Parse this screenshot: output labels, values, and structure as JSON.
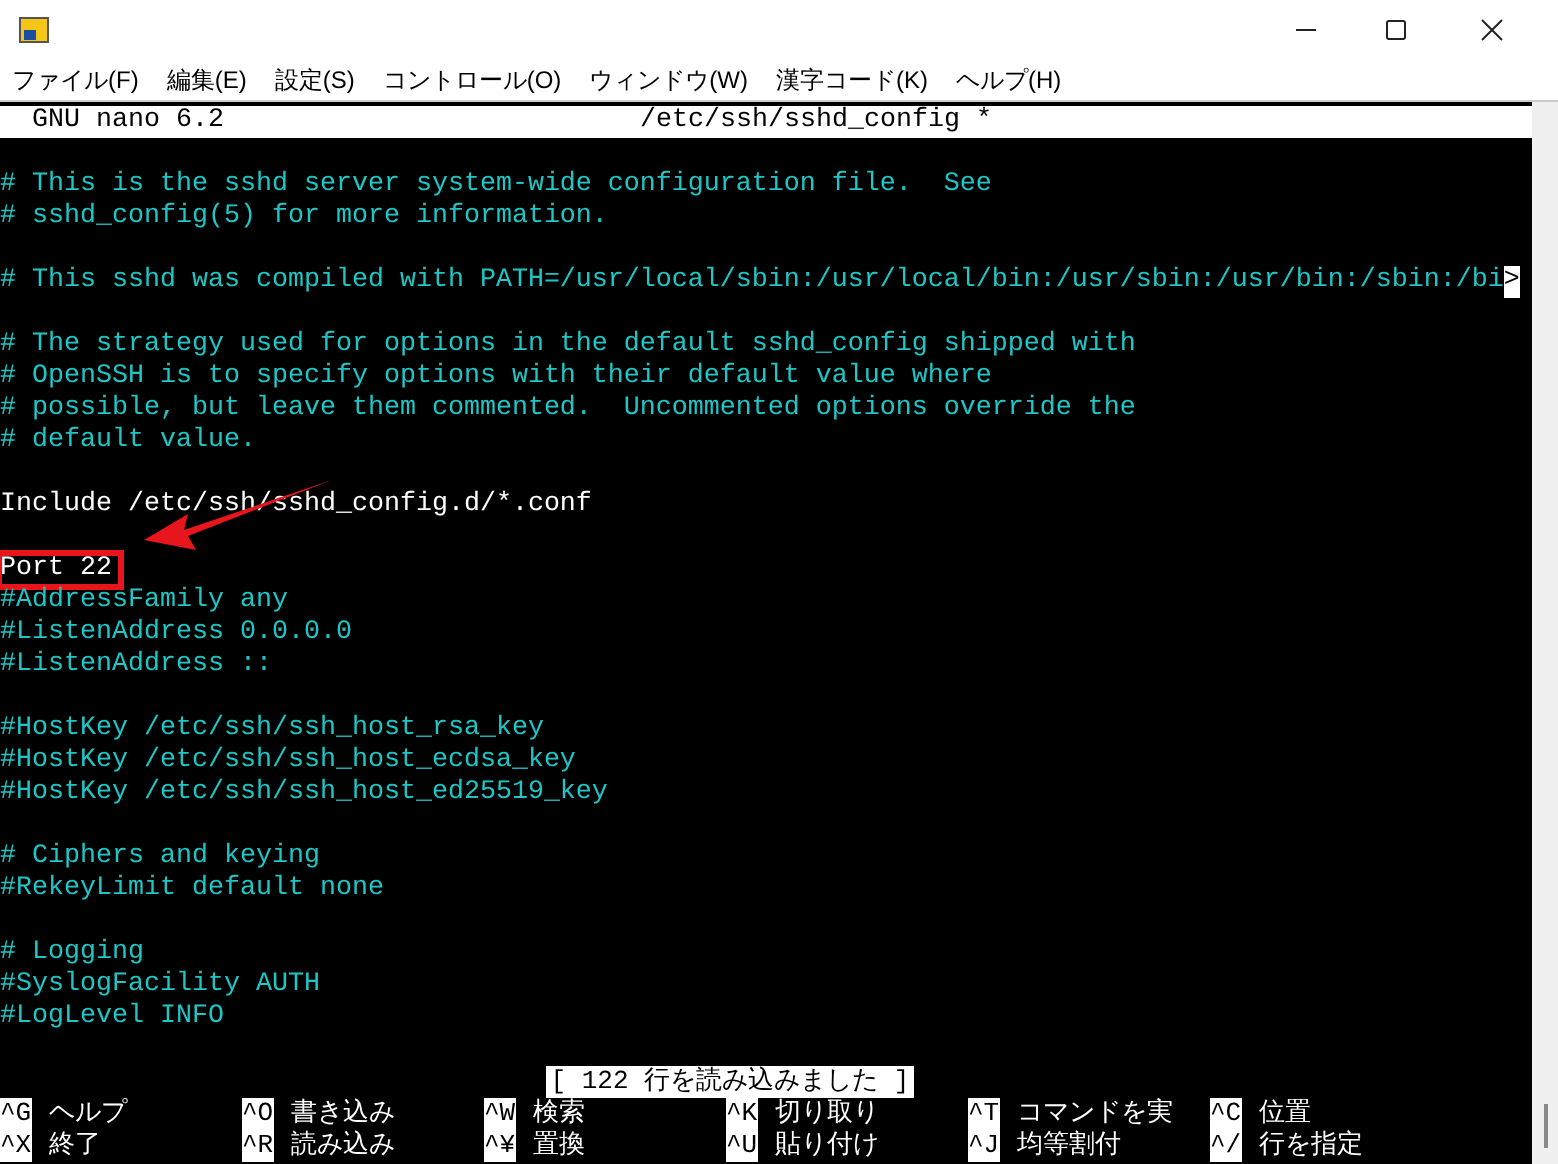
{
  "menu": [
    "ファイル(F)",
    "編集(E)",
    "設定(S)",
    "コントロール(O)",
    "ウィンドウ(W)",
    "漢字コード(K)",
    "ヘルプ(H)"
  ],
  "header": {
    "app": "GNU nano 6.2",
    "file": "/etc/ssh/sshd_config *"
  },
  "lines": [
    {
      "kind": "comment",
      "text": "# This is the sshd server system-wide configuration file.  See"
    },
    {
      "kind": "comment",
      "text": "# sshd_config(5) for more information."
    },
    {
      "kind": "blank"
    },
    {
      "kind": "comment",
      "text": "# This sshd was compiled with PATH=/usr/local/sbin:/usr/local/bin:/usr/sbin:/usr/bin:/sbin:/bi",
      "more": ">"
    },
    {
      "kind": "blank"
    },
    {
      "kind": "comment",
      "text": "# The strategy used for options in the default sshd_config shipped with"
    },
    {
      "kind": "comment",
      "text": "# OpenSSH is to specify options with their default value where"
    },
    {
      "kind": "comment",
      "text": "# possible, but leave them commented.  Uncommented options override the"
    },
    {
      "kind": "comment",
      "text": "# default value."
    },
    {
      "kind": "blank"
    },
    {
      "kind": "code",
      "text": "Include /etc/ssh/sshd_config.d/*.conf"
    },
    {
      "kind": "blank"
    },
    {
      "kind": "code",
      "text": "Port 22",
      "highlighted": true
    },
    {
      "kind": "comment",
      "text": "#AddressFamily any"
    },
    {
      "kind": "comment",
      "text": "#ListenAddress 0.0.0.0"
    },
    {
      "kind": "comment",
      "text": "#ListenAddress ::"
    },
    {
      "kind": "blank"
    },
    {
      "kind": "comment",
      "text": "#HostKey /etc/ssh/ssh_host_rsa_key"
    },
    {
      "kind": "comment",
      "text": "#HostKey /etc/ssh/ssh_host_ecdsa_key"
    },
    {
      "kind": "comment",
      "text": "#HostKey /etc/ssh/ssh_host_ed25519_key"
    },
    {
      "kind": "blank"
    },
    {
      "kind": "comment",
      "text": "# Ciphers and keying"
    },
    {
      "kind": "comment",
      "text": "#RekeyLimit default none"
    },
    {
      "kind": "blank"
    },
    {
      "kind": "comment",
      "text": "# Logging"
    },
    {
      "kind": "comment",
      "text": "#SyslogFacility AUTH"
    },
    {
      "kind": "comment",
      "text": "#LogLevel INFO"
    }
  ],
  "status": "[ 122 行を読み込みました ]",
  "shortcuts": [
    {
      "key": "^G",
      "label": "ヘルプ"
    },
    {
      "key": "^O",
      "label": "書き込み"
    },
    {
      "key": "^W",
      "label": "検索"
    },
    {
      "key": "^K",
      "label": "切り取り"
    },
    {
      "key": "^T",
      "label": "コマンドを実"
    },
    {
      "key": "^C",
      "label": "位置"
    },
    {
      "key": "^X",
      "label": "終了"
    },
    {
      "key": "^R",
      "label": "読み込み"
    },
    {
      "key": "^¥",
      "label": "置換"
    },
    {
      "key": "^U",
      "label": "貼り付け"
    },
    {
      "key": "^J",
      "label": "均等割付"
    },
    {
      "key": "^/",
      "label": "行を指定"
    }
  ]
}
